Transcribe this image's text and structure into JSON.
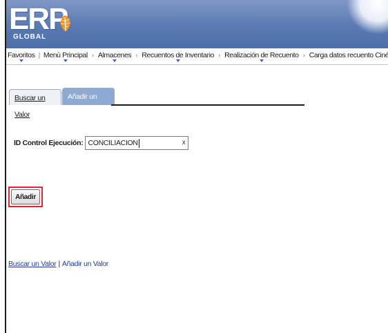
{
  "header": {
    "logo_main": "ERP",
    "logo_sub": "GLOBAL",
    "colors": {
      "header_top": "#7f97c6",
      "header_bottom": "#4d6ea9",
      "logo_leaf": "#f7941d"
    }
  },
  "nav": {
    "favoritos": "Favoritos",
    "menu_principal": "Menú Principal",
    "almacenes": "Almacenes",
    "recuentos": "Recuentos de Inventario",
    "realizacion": "Realización de Recuento",
    "carga": "Carga datos recuento Cinépolis",
    "separator": "›"
  },
  "tabs": {
    "buscar": "Buscar un Valor",
    "anadir": "Añadir un Valor",
    "active": "Añadir un Valor"
  },
  "form": {
    "field_label": "ID Control Ejecución:",
    "field_value": "CONCILIACION",
    "clear_label": "x"
  },
  "actions": {
    "add_label": "Añadir",
    "highlight_color": "#e0262b"
  },
  "footer_links": {
    "buscar": "Buscar un Valor",
    "separator": "|",
    "anadir": "Añadir un Valor"
  }
}
